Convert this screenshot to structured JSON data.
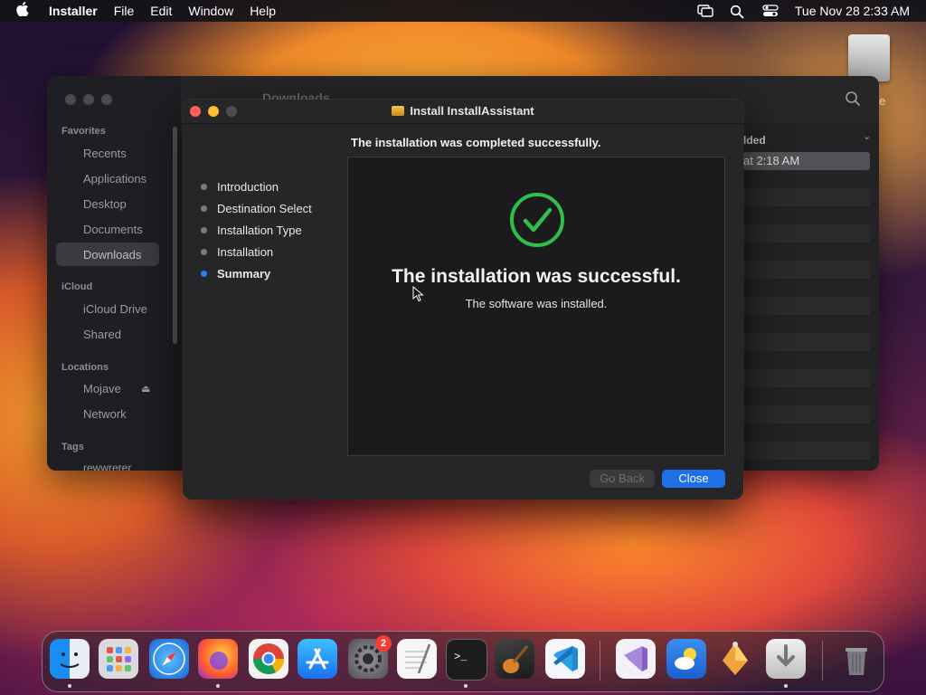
{
  "menubar": {
    "apple": "",
    "app_name": "Installer",
    "menus": [
      "File",
      "Edit",
      "Window",
      "Help"
    ],
    "datetime": "Tue Nov 28  2:33 AM",
    "status_icons": [
      "screen-mirroring-icon",
      "search-icon",
      "control-center-icon"
    ]
  },
  "desktop": {
    "drive_label": "e"
  },
  "finder": {
    "sidebar": {
      "favorites_label": "Favorites",
      "favorites": [
        "Recents",
        "Applications",
        "Desktop",
        "Documents",
        "Downloads"
      ],
      "icloud_label": "iCloud",
      "icloud": [
        "iCloud Drive",
        "Shared"
      ],
      "locations_label": "Locations",
      "locations": [
        "Mojave",
        "Network"
      ],
      "tags_label": "Tags",
      "tags": [
        "rewwrerer"
      ]
    },
    "title": "Downloads",
    "column_header": "lded",
    "selected_row": "at 2:18 AM"
  },
  "installer": {
    "title": "Install InstallAssistant",
    "header": "The installation was completed successfully.",
    "steps": [
      "Introduction",
      "Destination Select",
      "Installation Type",
      "Installation",
      "Summary"
    ],
    "active_step": "Summary",
    "success_title": "The installation was successful.",
    "success_subtitle": "The software was installed.",
    "buttons": {
      "back": "Go Back",
      "close": "Close"
    },
    "colors": {
      "accent": "#1f6fe8",
      "success": "#2fbf4a"
    }
  },
  "dock": {
    "apps": [
      "Finder",
      "Launchpad",
      "Safari",
      "Firefox",
      "Chrome",
      "App Store",
      "System Settings",
      "TextEdit",
      "Terminal",
      "GarageBand",
      "Visual Studio Code",
      "Visual Studio",
      "Weather",
      "Installer",
      "Downloads",
      "Trash"
    ],
    "settings_badge": "2"
  }
}
